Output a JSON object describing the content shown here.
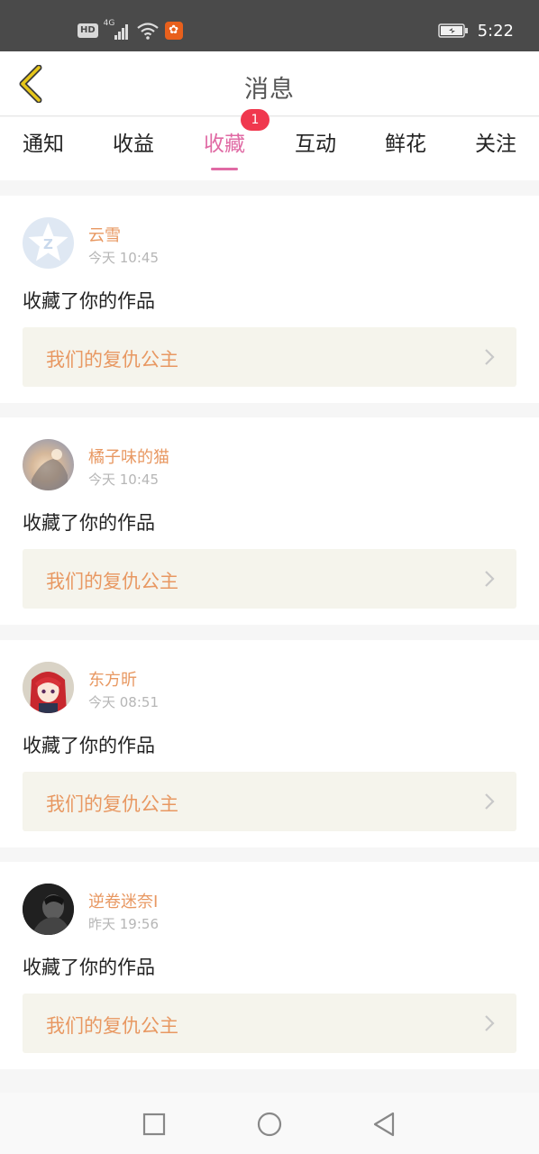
{
  "status_bar": {
    "hd": "HD",
    "network": "4G",
    "time": "5:22"
  },
  "header": {
    "title": "消息",
    "back_icon": "chevron-left-icon",
    "back_color": "#e6c619"
  },
  "tabs": [
    {
      "label": "通知",
      "active": false
    },
    {
      "label": "收益",
      "active": false
    },
    {
      "label": "收藏",
      "active": true,
      "badge": "1"
    },
    {
      "label": "互动",
      "active": false
    },
    {
      "label": "鲜花",
      "active": false
    },
    {
      "label": "关注",
      "active": false
    }
  ],
  "colors": {
    "accent": "#e06aa4",
    "badge": "#f0384e",
    "name": "#e89862",
    "link_bg": "#f5f4ec"
  },
  "messages": [
    {
      "name": "云雪",
      "time": "今天 10:45",
      "action": "收藏了你的作品",
      "work": "我们的复仇公主",
      "avatar": "default-star-avatar"
    },
    {
      "name": "橘子味的猫",
      "time": "今天 10:45",
      "action": "收藏了你的作品",
      "work": "我们的复仇公主",
      "avatar": "photo-avatar"
    },
    {
      "name": "东方昕",
      "time": "今天 08:51",
      "action": "收藏了你的作品",
      "work": "我们的复仇公主",
      "avatar": "anime-avatar"
    },
    {
      "name": "逆卷迷奈I",
      "time": "昨天 19:56",
      "action": "收藏了你的作品",
      "work": "我们的复仇公主",
      "avatar": "dark-photo-avatar"
    }
  ],
  "nav_bar": {
    "recent": "square-icon",
    "home": "circle-icon",
    "back": "triangle-back-icon"
  }
}
